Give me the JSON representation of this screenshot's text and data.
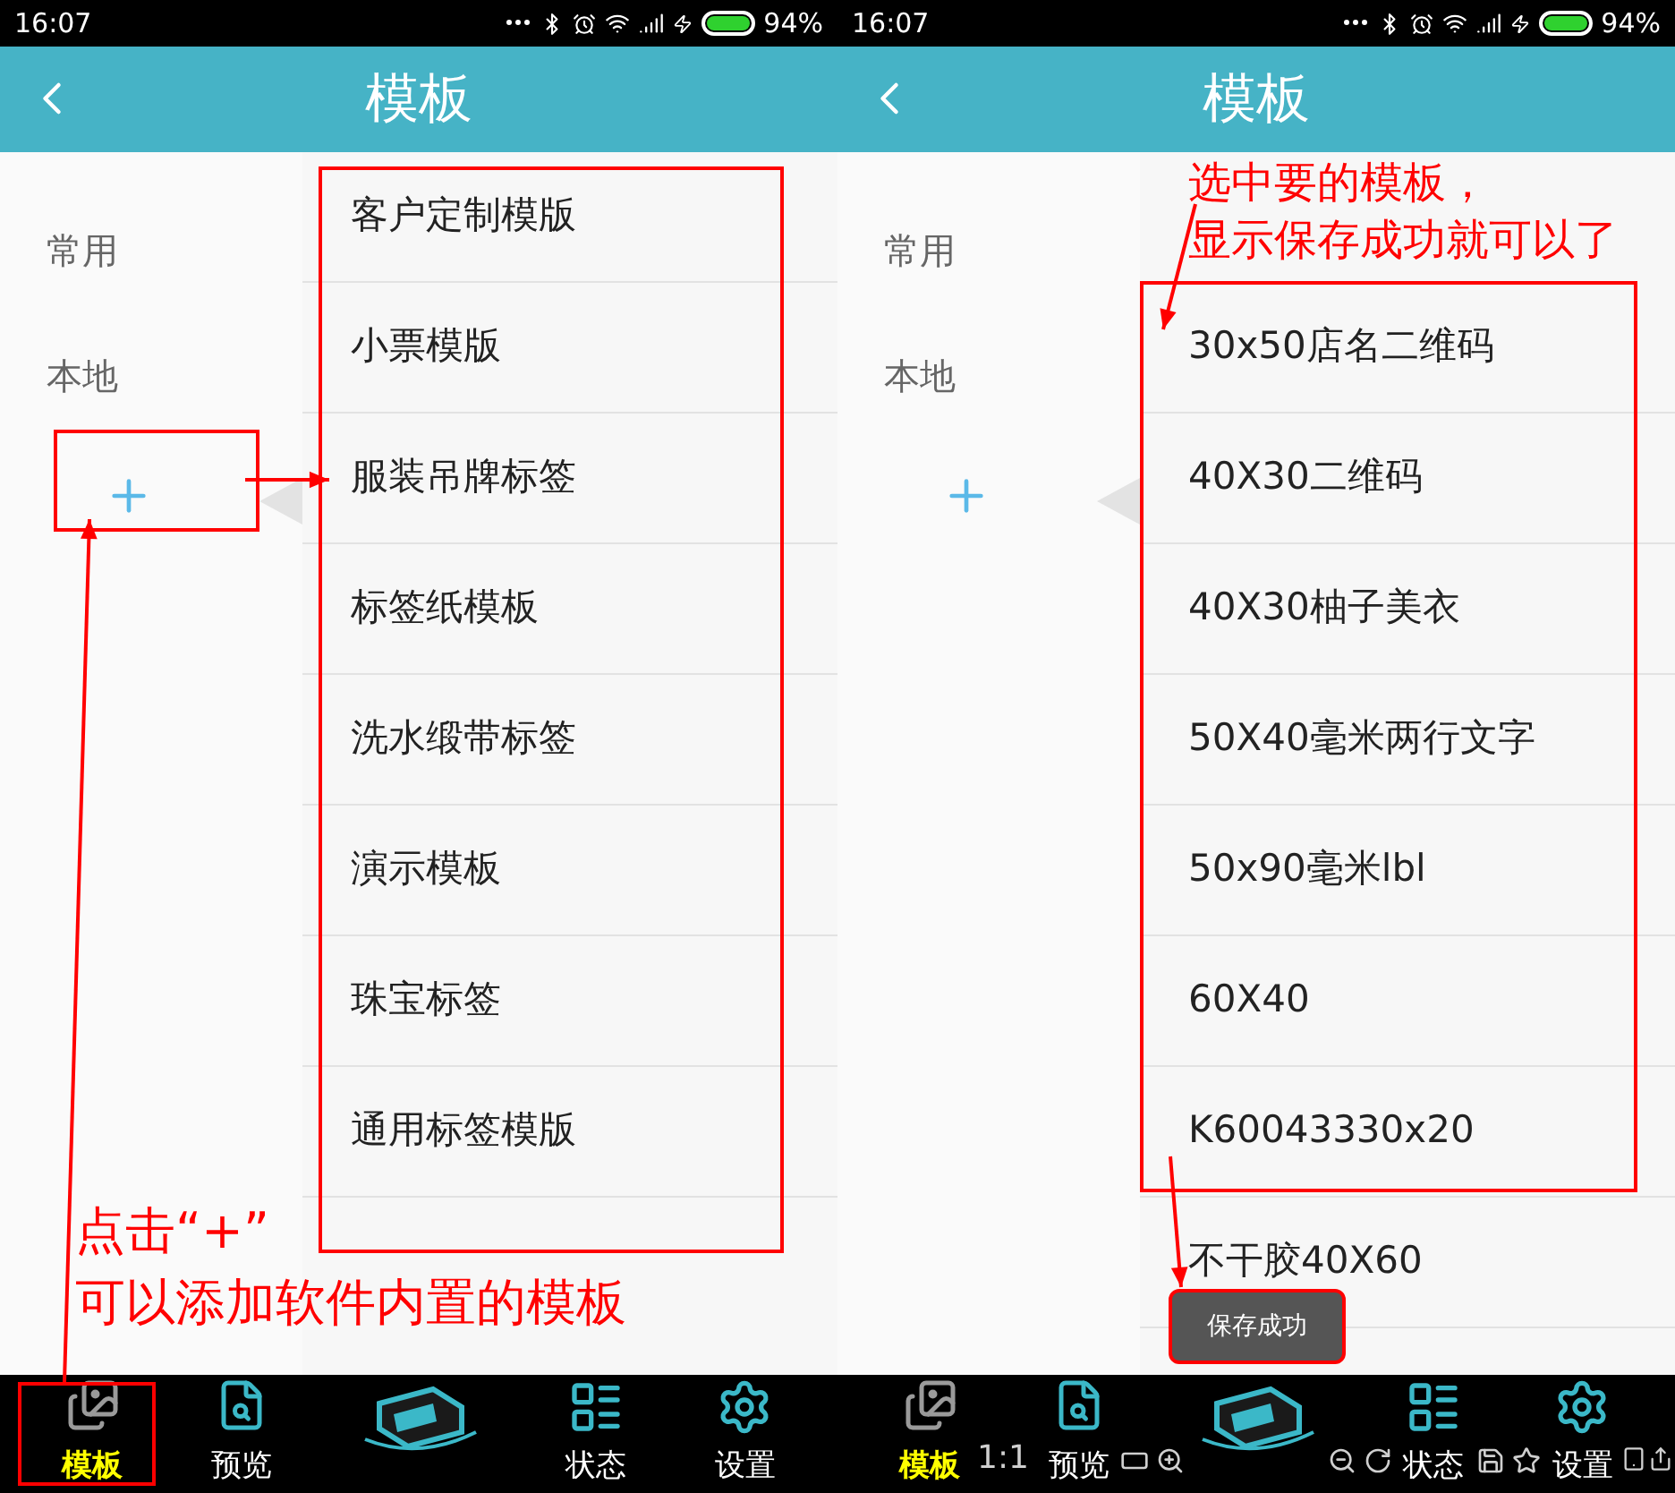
{
  "panels": [
    {
      "status_bar": {
        "time": "16:07",
        "battery": "94%"
      },
      "header": {
        "title": "模板"
      },
      "sidebar": [
        {
          "label": "常用"
        },
        {
          "label": "本地"
        }
      ],
      "list": [
        {
          "label": "客户定制模版"
        },
        {
          "label": "小票模版"
        },
        {
          "label": "服装吊牌标签"
        },
        {
          "label": "标签纸模板"
        },
        {
          "label": "洗水缎带标签"
        },
        {
          "label": "演示模板"
        },
        {
          "label": "珠宝标签"
        },
        {
          "label": "通用标签模版"
        }
      ],
      "note": {
        "kind": "bottom",
        "lines": [
          "点击“+”",
          "可以添加软件内置的模板"
        ]
      },
      "nav": [
        {
          "kind": "templates",
          "label": "模板",
          "selected": true
        },
        {
          "kind": "preview",
          "label": "预览",
          "selected": false
        },
        {
          "kind": "printer"
        },
        {
          "kind": "status",
          "label": "状态",
          "selected": false
        },
        {
          "kind": "settings",
          "label": "设置",
          "selected": false
        }
      ]
    },
    {
      "status_bar": {
        "time": "16:07",
        "battery": "94%"
      },
      "header": {
        "title": "模板"
      },
      "sidebar": [
        {
          "label": "常用"
        },
        {
          "label": "本地"
        }
      ],
      "note": {
        "kind": "top",
        "lines": [
          "选中要的模板，",
          "显示保存成功就可以了"
        ]
      },
      "list": [
        {
          "label": "30x50店名二维码"
        },
        {
          "label": "40X30二维码"
        },
        {
          "label": "40X30柚子美衣"
        },
        {
          "label": "50X40毫米两行文字"
        },
        {
          "label": "50x90毫米lbl"
        },
        {
          "label": "60X40"
        },
        {
          "label": "K60043330x20"
        },
        {
          "label": "不干胶40X60"
        }
      ],
      "toast": "保存成功",
      "viewer_toolbar": {
        "zoom_label": "1:1"
      },
      "nav": [
        {
          "kind": "templates",
          "label": "模板",
          "selected": true
        },
        {
          "kind": "preview",
          "label": "预览",
          "selected": false
        },
        {
          "kind": "printer"
        },
        {
          "kind": "status",
          "label": "状态",
          "selected": false
        },
        {
          "kind": "settings",
          "label": "设置",
          "selected": false
        }
      ]
    }
  ]
}
